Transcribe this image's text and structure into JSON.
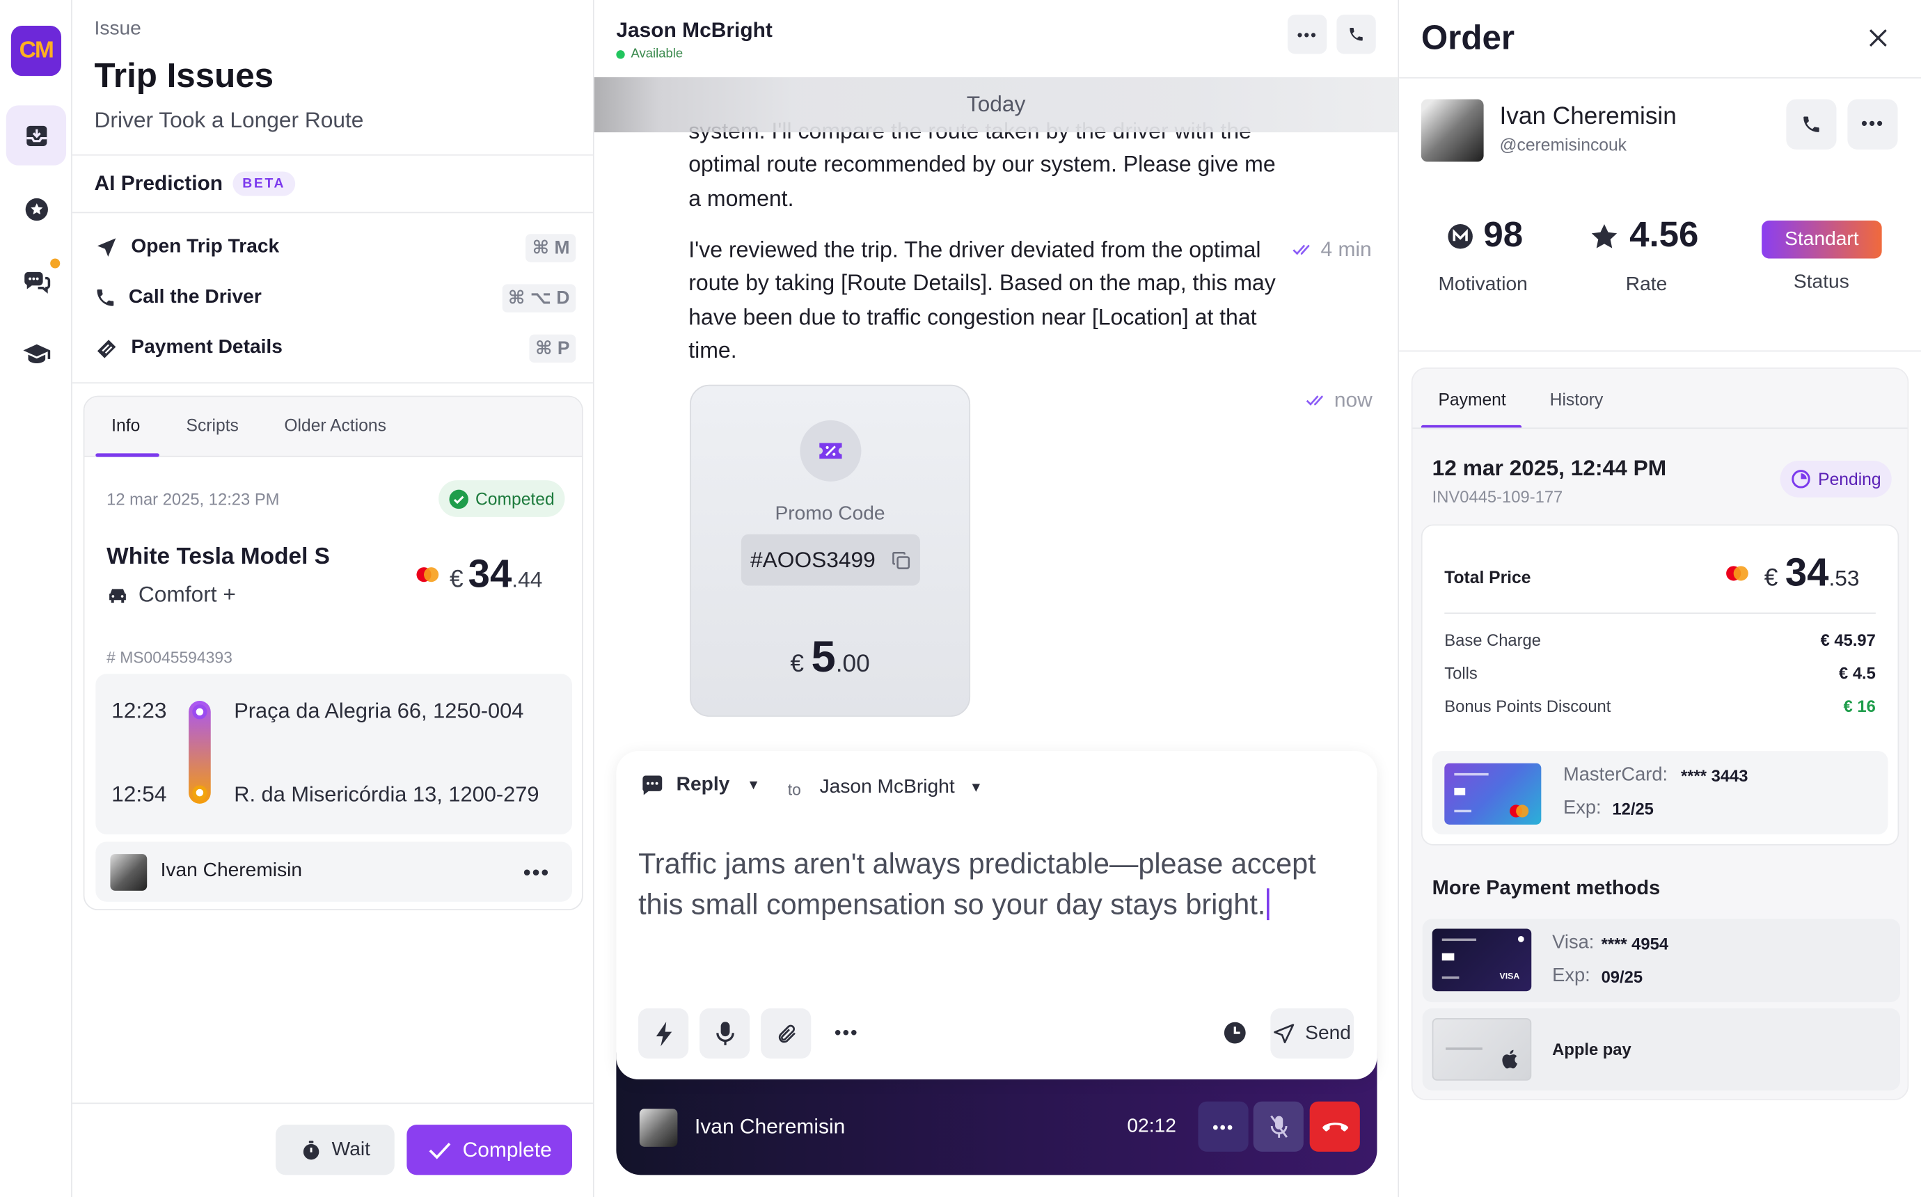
{
  "brand": {
    "logo_text": "CM",
    "accent": "#7c3aed"
  },
  "rail": {
    "items": [
      {
        "icon": "inbox-icon",
        "active": true
      },
      {
        "icon": "star-badge-icon"
      },
      {
        "icon": "chat-bubbles-icon",
        "badge": true
      },
      {
        "icon": "graduation-cap-icon"
      }
    ]
  },
  "issue": {
    "eyebrow": "Issue",
    "title": "Trip Issues",
    "subtitle": "Driver Took a Longer Route",
    "ai_label": "AI Prediction",
    "ai_badge": "BETA",
    "actions": [
      {
        "label": "Open Trip Track",
        "shortcut": "⌘ M",
        "icon": "navigation-arrow-icon"
      },
      {
        "label": "Call the Driver",
        "shortcut": "⌘ ⌥ D",
        "icon": "phone-icon"
      },
      {
        "label": "Payment Details",
        "shortcut": "⌘ P",
        "icon": "payment-icon"
      }
    ],
    "tabs": [
      "Info",
      "Scripts",
      "Older Actions"
    ],
    "trip": {
      "date": "12 mar 2025, 12:23 PM",
      "status": "Competed",
      "car": "White Tesla Model S",
      "class": "Comfort +",
      "currency": "€",
      "price_int": "34",
      "price_dec": ".44",
      "id": "# MS0045594393",
      "start_time": "12:23",
      "start_addr": "Praça da Alegria 66, 1250-004",
      "end_time": "12:54",
      "end_addr": "R. da Misericórdia 13, 1200-279",
      "driver": "Ivan Cheremisin"
    },
    "wait_label": "Wait",
    "complete_label": "Complete"
  },
  "chat": {
    "name": "Jason McBright",
    "status": "Available",
    "day_label": "Today",
    "msg_partial": "system. I'll compare the route taken by the driver with the optimal route recommended by our system. Please give me a moment.",
    "msg2": "I've reviewed the trip. The driver deviated from the optimal route by taking [Route Details]. Based on the map, this may have been due to traffic congestion near [Location] at that time.",
    "msg2_time": "4 min",
    "promo_time": "now",
    "promo": {
      "label": "Promo Code",
      "code": "#AOOS3499",
      "currency": "€",
      "amount_int": "5",
      "amount_dec": ".00"
    },
    "composer": {
      "mode": "Reply",
      "to_label": "to",
      "to": "Jason McBright",
      "text": "Traffic jams aren't always predictable—please accept this small compensation so your day stays bright.",
      "send": "Send"
    },
    "call": {
      "name": "Ivan Cheremisin",
      "timer": "02:12"
    }
  },
  "order": {
    "title": "Order",
    "customer": "Ivan Cheremisin",
    "handle": "@ceremisincouk",
    "stats": {
      "motivation": "98",
      "motivation_label": "Motivation",
      "rate": "4.56",
      "rate_label": "Rate",
      "status": "Standart",
      "status_label": "Status"
    },
    "tabs": [
      "Payment",
      "History"
    ],
    "pay_date": "12 mar 2025, 12:44 PM",
    "invoice": "INV0445-109-177",
    "pay_status": "Pending",
    "total_label": "Total Price",
    "currency": "€",
    "total_int": "34",
    "total_dec": ".53",
    "lines": [
      {
        "label": "Base Charge",
        "value": "€ 45.97"
      },
      {
        "label": "Tolls",
        "value": "€ 4.5"
      },
      {
        "label": "Bonus Points Discount",
        "value": "€ 16"
      }
    ],
    "card": {
      "brand": "MasterCard:",
      "number": "**** 3443",
      "exp_label": "Exp:",
      "exp": "12/25"
    },
    "more_title": "More Payment methods",
    "visa": {
      "brand": "Visa:",
      "number": "**** 4954",
      "exp_label": "Exp:",
      "exp": "09/25",
      "logo": "VISA"
    },
    "apple": "Apple pay"
  }
}
